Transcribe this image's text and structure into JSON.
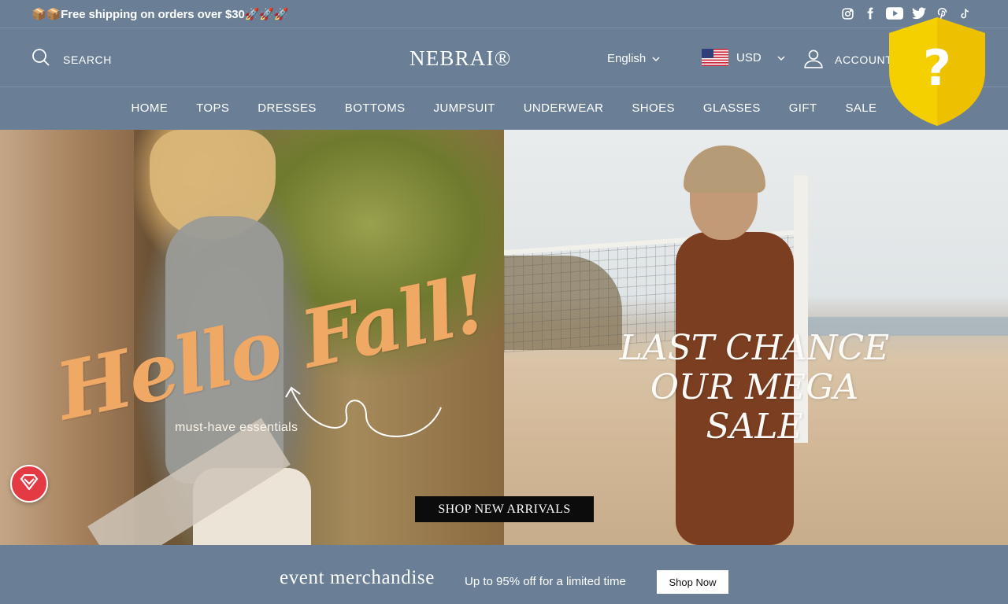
{
  "announcement": {
    "text": "📦📦Free shipping on orders over $30🚀🚀🚀"
  },
  "socials": [
    "instagram-icon",
    "facebook-icon",
    "youtube-icon",
    "twitter-icon",
    "pinterest-icon",
    "tiktok-icon"
  ],
  "header": {
    "search_label": "SEARCH",
    "logo": "NEBRAI®",
    "language": "English",
    "currency": "USD",
    "account_label": "ACCOUNT"
  },
  "nav": {
    "items": [
      "HOME",
      "TOPS",
      "DRESSES",
      "BOTTOMS",
      "JUMPSUIT",
      "UNDERWEAR",
      "SHOES",
      "GLASSES",
      "GIFT",
      "SALE"
    ]
  },
  "hero": {
    "left_headline": "Hello Fall!",
    "left_sub": "must-have essentials",
    "right_headline_line1": "LAST CHANCE",
    "right_headline_line2": "OUR MEGA SALE",
    "cta": "SHOP NEW ARRIVALS"
  },
  "promo": {
    "title": "event merchandise",
    "subtitle": "Up to 95% off for a limited time",
    "button": "Shop Now"
  },
  "colors": {
    "bar": "#6a7f96",
    "hello_fall": "#f0a865",
    "badge": "#f5d000",
    "float_button": "#e33a44"
  }
}
